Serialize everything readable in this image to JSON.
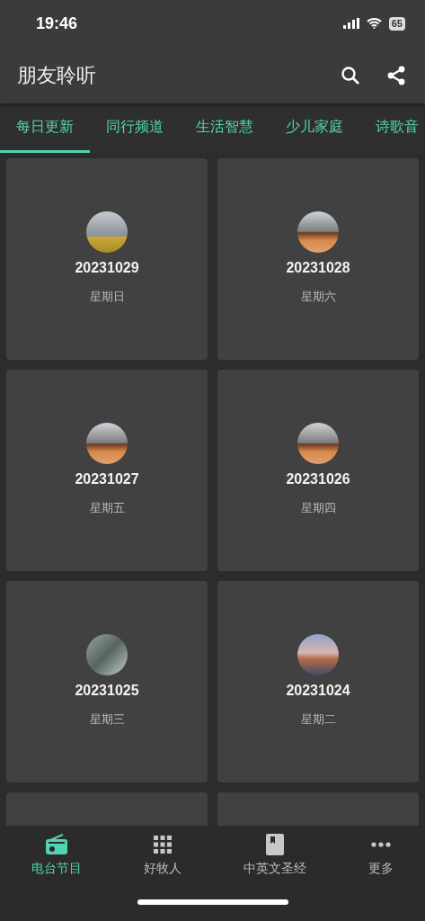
{
  "status_bar": {
    "time": "19:46",
    "battery": "65"
  },
  "app_bar": {
    "title": "朋友聆听"
  },
  "tabs": [
    {
      "label": "每日更新",
      "selected": true
    },
    {
      "label": "同行频道",
      "selected": false
    },
    {
      "label": "生活智慧",
      "selected": false
    },
    {
      "label": "少儿家庭",
      "selected": false
    },
    {
      "label": "诗歌音",
      "selected": false
    }
  ],
  "episodes": [
    {
      "date": "20231029",
      "weekday": "星期日"
    },
    {
      "date": "20231028",
      "weekday": "星期六"
    },
    {
      "date": "20231027",
      "weekday": "星期五"
    },
    {
      "date": "20231026",
      "weekday": "星期四"
    },
    {
      "date": "20231025",
      "weekday": "星期三"
    },
    {
      "date": "20231024",
      "weekday": "星期二"
    }
  ],
  "bottom_nav": [
    {
      "label": "电台节目",
      "kind": "radio",
      "selected": true
    },
    {
      "label": "好牧人",
      "kind": "grid",
      "selected": false
    },
    {
      "label": "中英文圣经",
      "kind": "book",
      "selected": false
    },
    {
      "label": "更多",
      "kind": "more",
      "selected": false
    }
  ]
}
